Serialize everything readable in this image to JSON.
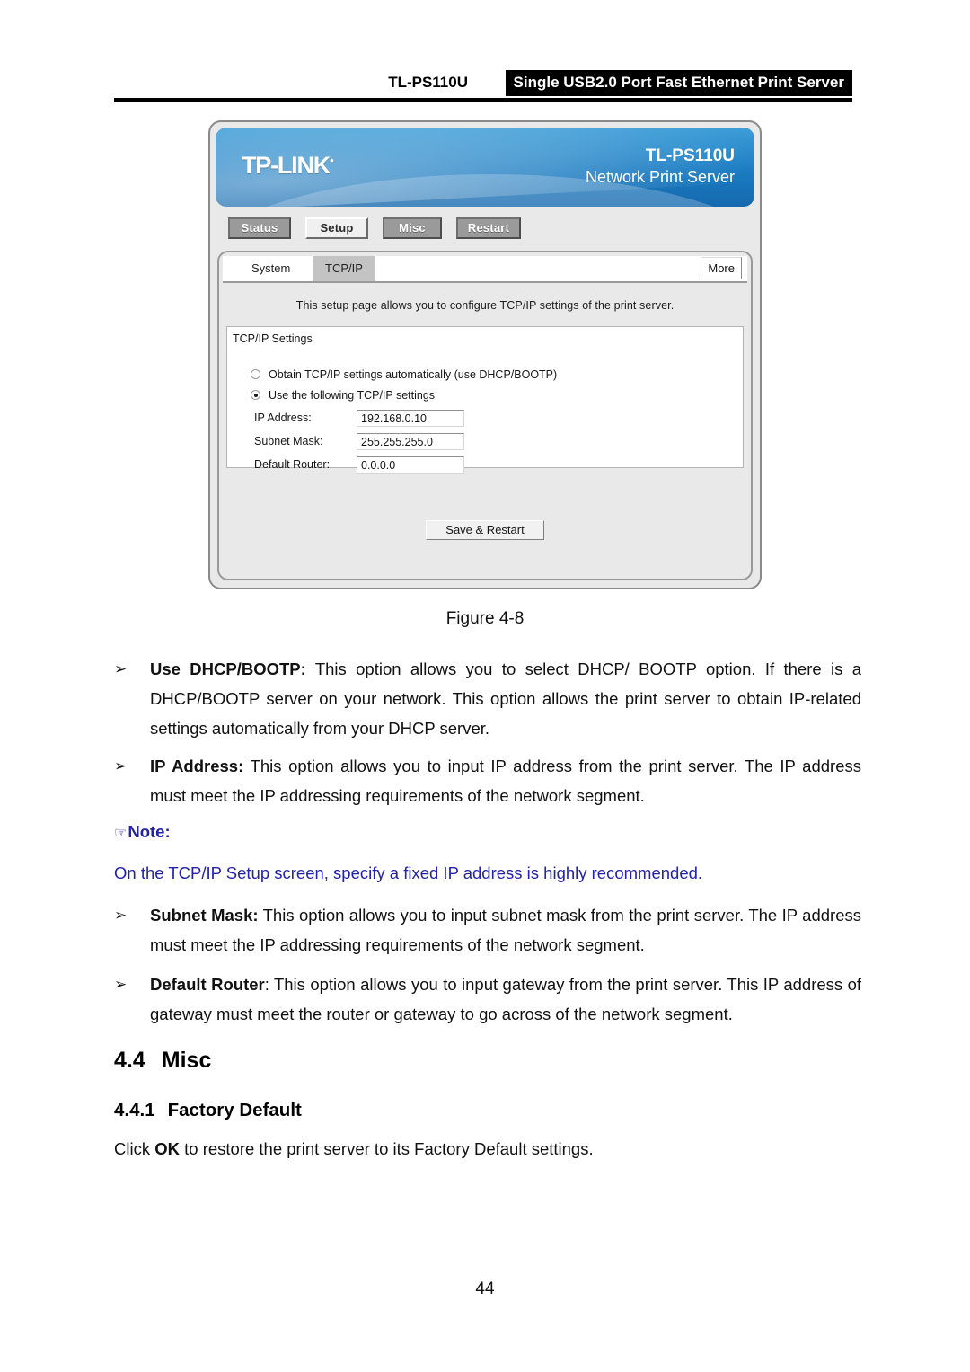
{
  "header": {
    "model": "TL-PS110U",
    "title": "Single USB2.0 Port Fast Ethernet Print Server"
  },
  "screenshot": {
    "banner": {
      "logo": "TP-LINK",
      "model": "TL-PS110U",
      "subtitle": "Network Print Server"
    },
    "nav_buttons": [
      {
        "label": "Status",
        "active": false
      },
      {
        "label": "Setup",
        "active": true
      },
      {
        "label": "Misc",
        "active": false
      },
      {
        "label": "Restart",
        "active": false
      }
    ],
    "tabs": [
      {
        "label": "System",
        "selected": false
      },
      {
        "label": "TCP/IP",
        "selected": true
      }
    ],
    "more_button": "More",
    "description": "This setup page allows you to configure TCP/IP settings of the print server.",
    "fieldset": {
      "legend": "TCP/IP Settings",
      "radios": [
        {
          "label": "Obtain TCP/IP settings automatically (use DHCP/BOOTP)",
          "checked": false
        },
        {
          "label": "Use the following TCP/IP settings",
          "checked": true
        }
      ],
      "fields": [
        {
          "label": "IP Address:",
          "value": "192.168.0.10"
        },
        {
          "label": "Subnet Mask:",
          "value": "255.255.255.0"
        },
        {
          "label": "Default Router:",
          "value": "0.0.0.0"
        }
      ]
    },
    "save_button": "Save & Restart"
  },
  "figure_caption": "Figure 4-8",
  "bullets": [
    {
      "marker": "➢",
      "bold": "Use DHCP/BOOTP:",
      "text": " This option allows you to select DHCP/ BOOTP option. If there is a DHCP/BOOTP server on your network. This option allows the print server to obtain IP-related settings automatically from your DHCP server."
    },
    {
      "marker": "➢",
      "bold": "IP Address:",
      "text": " This option allows you to input IP address from the print server. The IP address must meet the IP addressing requirements of the network segment."
    },
    {
      "marker": "➢",
      "bold": "Subnet Mask:",
      "text": " This option allows you to input subnet mask from the print server. The IP address must meet the IP addressing requirements of the network segment."
    },
    {
      "marker": "➢",
      "bold": "Default Router",
      "text": ": This option allows you to input gateway from the print server. This IP address of gateway must meet the router or gateway to go across of the network segment."
    }
  ],
  "note": {
    "hand_icon": "☞",
    "label": "Note:",
    "body": "On the TCP/IP Setup screen, specify a fixed IP address is highly recommended.",
    "color": "#2222aa"
  },
  "headings": {
    "h2_number": "4.4",
    "h2_title": "Misc",
    "h3_number": "4.4.1",
    "h3_title": "Factory Default"
  },
  "paragraph": {
    "prefix": "Click ",
    "bold": "OK",
    "suffix": " to restore the print server to its Factory Default settings."
  },
  "page_number": "44"
}
